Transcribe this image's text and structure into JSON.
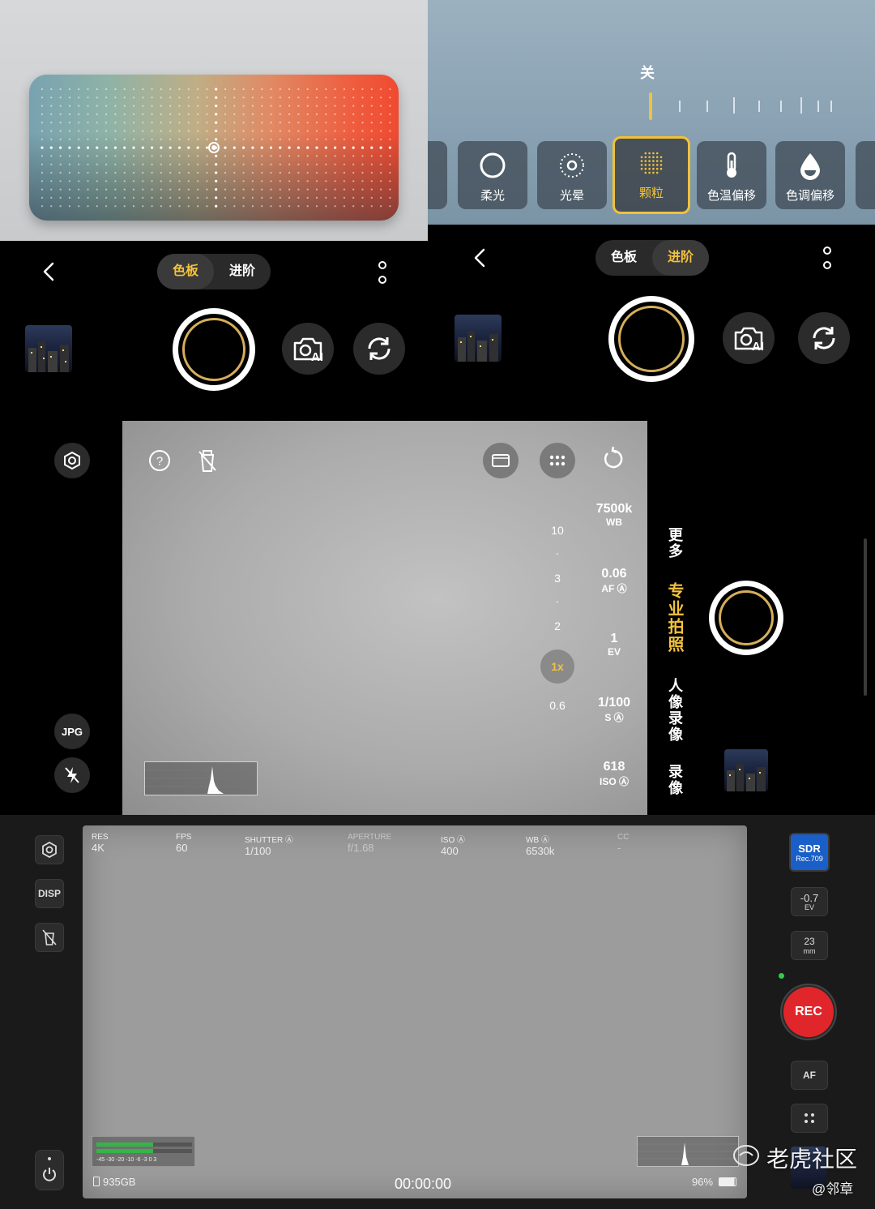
{
  "palette_panel": {},
  "filter_panel": {
    "strength_label": "关",
    "filters": [
      {
        "label": "柔光",
        "icon": "ring-icon"
      },
      {
        "label": "光晕",
        "icon": "halo-icon"
      },
      {
        "label": "颗粒",
        "icon": "grain-icon",
        "selected": true
      },
      {
        "label": "色温偏移",
        "icon": "thermometer-icon"
      },
      {
        "label": "色调偏移",
        "icon": "droplet-icon"
      }
    ]
  },
  "camera_left": {
    "tab_palette": "色板",
    "tab_advanced": "进阶",
    "active_tab": "色板"
  },
  "camera_right": {
    "tab_palette": "色板",
    "tab_advanced": "进阶",
    "active_tab": "进阶"
  },
  "ai_label": "AI",
  "pro_photo": {
    "zoom_levels": [
      "10",
      "·",
      "3",
      "·",
      "2",
      "1x",
      "0.6"
    ],
    "params": [
      {
        "value": "7500k",
        "unit": "WB"
      },
      {
        "value": "0.06",
        "unit": "AF Ⓐ"
      },
      {
        "value": "1",
        "unit": "EV"
      },
      {
        "value": "1/100",
        "unit": "S Ⓐ"
      },
      {
        "value": "618",
        "unit": "ISO Ⓐ"
      }
    ],
    "modes": [
      "更多",
      "专业拍照",
      "人像录像",
      "录像"
    ],
    "active_mode": "专业拍照",
    "jpg_label": "JPG"
  },
  "video": {
    "stats": [
      {
        "key": "RES",
        "value": "4K"
      },
      {
        "key": "FPS",
        "value": "60"
      },
      {
        "key": "SHUTTER Ⓐ",
        "value": "1/100"
      },
      {
        "key": "APERTURE",
        "value": "f/1.68"
      },
      {
        "key": "ISO Ⓐ",
        "value": "400"
      },
      {
        "key": "WB Ⓐ",
        "value": "6530k"
      },
      {
        "key": "CC",
        "value": "-"
      }
    ],
    "disp_label": "DISP",
    "sdr_label": "SDR",
    "sdr_sub": "Rec.709",
    "ev_value": "-0.7",
    "ev_unit": "EV",
    "focal_value": "23",
    "focal_unit": "mm",
    "rec_label": "REC",
    "af_label": "AF",
    "storage": "935GB",
    "timecode": "00:00:00",
    "battery": "96%",
    "meter_scale": "-45 -30 -20    -10 -6 -3  0 3"
  },
  "watermark": {
    "site": "老虎社区",
    "author": "@邻章"
  },
  "colors": {
    "accent": "#f2c23e",
    "rec": "#e0262a",
    "sdr": "#1a5fc8"
  }
}
